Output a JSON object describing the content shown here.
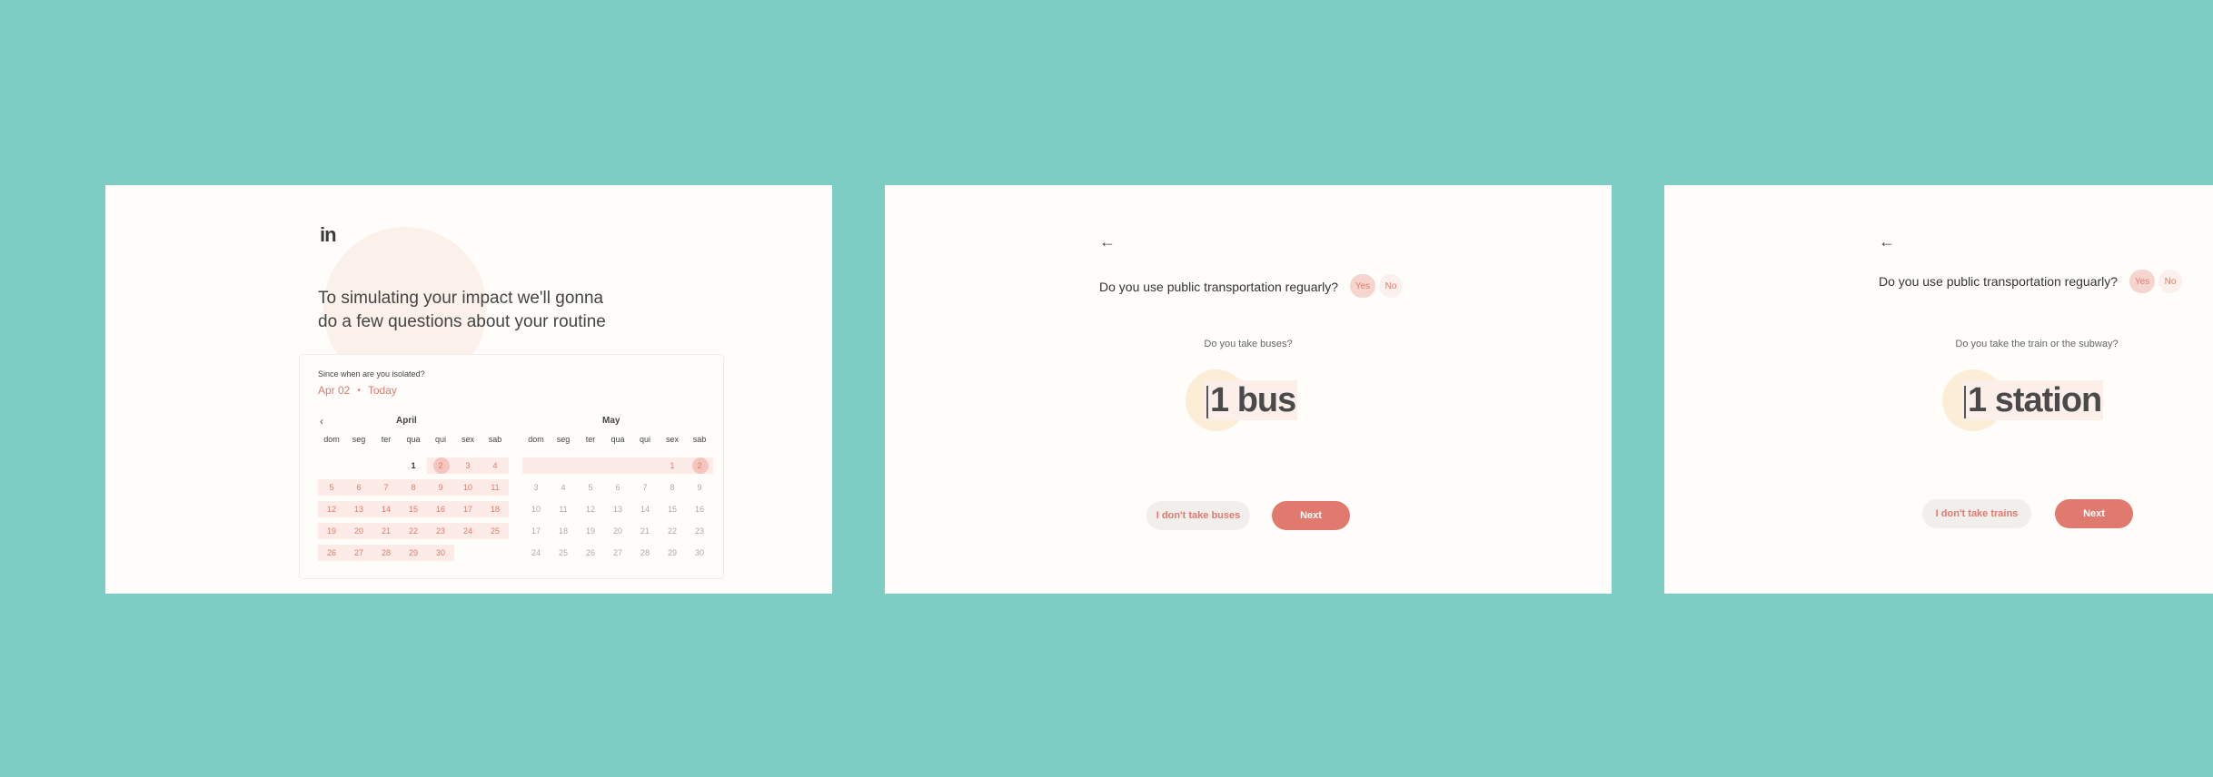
{
  "screen1": {
    "logo": "in",
    "title": "To simulating your impact we'll gonna do a few questions about your routine",
    "since_label": "Since when are you isolated?",
    "range_start": "Apr 02",
    "range_sep": "•",
    "range_end": "Today",
    "prev_icon": "‹",
    "april": {
      "name": "April",
      "weekdays": [
        "dom",
        "seg",
        "ter",
        "qua",
        "qui",
        "sex",
        "sab"
      ],
      "days": [
        "",
        "",
        "",
        "1",
        "2",
        "3",
        "4",
        "5",
        "6",
        "7",
        "8",
        "9",
        "10",
        "11",
        "12",
        "13",
        "14",
        "15",
        "16",
        "17",
        "18",
        "19",
        "20",
        "21",
        "22",
        "23",
        "24",
        "25",
        "26",
        "27",
        "28",
        "29",
        "30",
        ""
      ]
    },
    "may": {
      "name": "May",
      "weekdays": [
        "dom",
        "seg",
        "ter",
        "qua",
        "qui",
        "sex",
        "sab"
      ],
      "days": [
        "",
        "",
        "",
        "",
        "",
        "1",
        "2",
        "3",
        "4",
        "5",
        "6",
        "7",
        "8",
        "9",
        "10",
        "11",
        "12",
        "13",
        "14",
        "15",
        "16",
        "17",
        "18",
        "19",
        "20",
        "21",
        "22",
        "23",
        "24",
        "25",
        "26",
        "27",
        "28",
        "29",
        "30"
      ]
    },
    "accent_color": "#E07A6E"
  },
  "screen2": {
    "back_icon": "←",
    "question": "Do you use public transportation reguarly?",
    "yes": "Yes",
    "no": "No",
    "sub_question": "Do you take buses?",
    "count_value": "1 bus",
    "skip_label": "I don't take buses",
    "next_label": "Next"
  },
  "screen3": {
    "back_icon": "←",
    "question": "Do you use public transportation reguarly?",
    "yes": "Yes",
    "no": "No",
    "sub_question": "Do you take the train or the subway?",
    "count_value": "1 station",
    "skip_label": "I don't take trains",
    "next_label": "Next"
  }
}
